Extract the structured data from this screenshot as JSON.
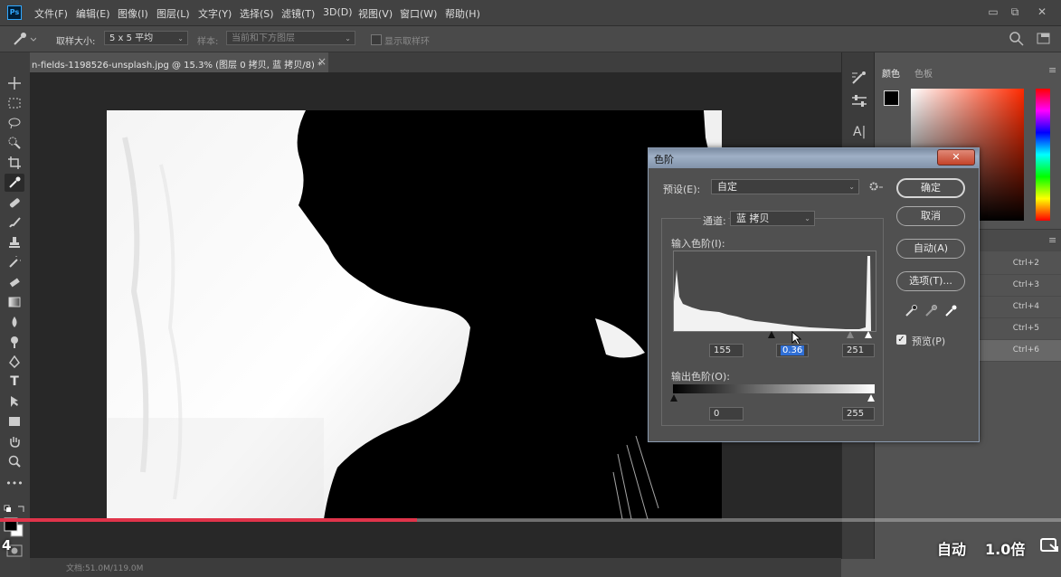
{
  "app": {
    "logo": "Ps",
    "menu": [
      "文件(F)",
      "编辑(E)",
      "图像(I)",
      "图层(L)",
      "文字(Y)",
      "选择(S)",
      "滤镜(T)",
      "3D(D)",
      "视图(V)",
      "窗口(W)",
      "帮助(H)"
    ]
  },
  "window_controls": {
    "minimize": "▭",
    "restore": "⧉",
    "close": "✕"
  },
  "options": {
    "sample_size_label": "取样大小:",
    "sample_size_value": "5 x 5 平均",
    "sample_label": "样本:",
    "sample_value": "当前和下方图层",
    "show_ring_label": "显示取样环"
  },
  "document": {
    "tab_title": "n-fields-1198526-unsplash.jpg @ 15.3% (图层 0 拷贝, 蓝 拷贝/8) *",
    "tab_close": "×",
    "status": "文档:51.0M/119.0M"
  },
  "panels": {
    "tabs": [
      "颜色",
      "色板"
    ],
    "shortcuts": [
      "Ctrl+2",
      "Ctrl+3",
      "Ctrl+4",
      "Ctrl+5",
      "Ctrl+6"
    ],
    "text_tool_glyph": "A|"
  },
  "levels": {
    "title": "色阶",
    "close": "✕",
    "preset_label": "预设(E):",
    "preset_value": "自定",
    "channel_label": "通道:",
    "channel_value": "蓝 拷贝",
    "input_label": "输入色阶(I):",
    "input_black": "155",
    "input_gamma": "0.36",
    "input_white": "251",
    "output_label": "输出色阶(O):",
    "output_black": "0",
    "output_white": "255",
    "buttons": {
      "ok": "确定",
      "cancel": "取消",
      "auto": "自动(A)",
      "options": "选项(T)..."
    },
    "preview_label": "预览(P)",
    "preview_checked": true
  },
  "video": {
    "progress": 0.393,
    "auto_label": "自动",
    "speed_label": "1.0倍",
    "left_number": "4"
  },
  "colors": {
    "accent_progress": "#e0344a",
    "title_bar": "#8a9bb2",
    "close_red": "#c4432a"
  }
}
